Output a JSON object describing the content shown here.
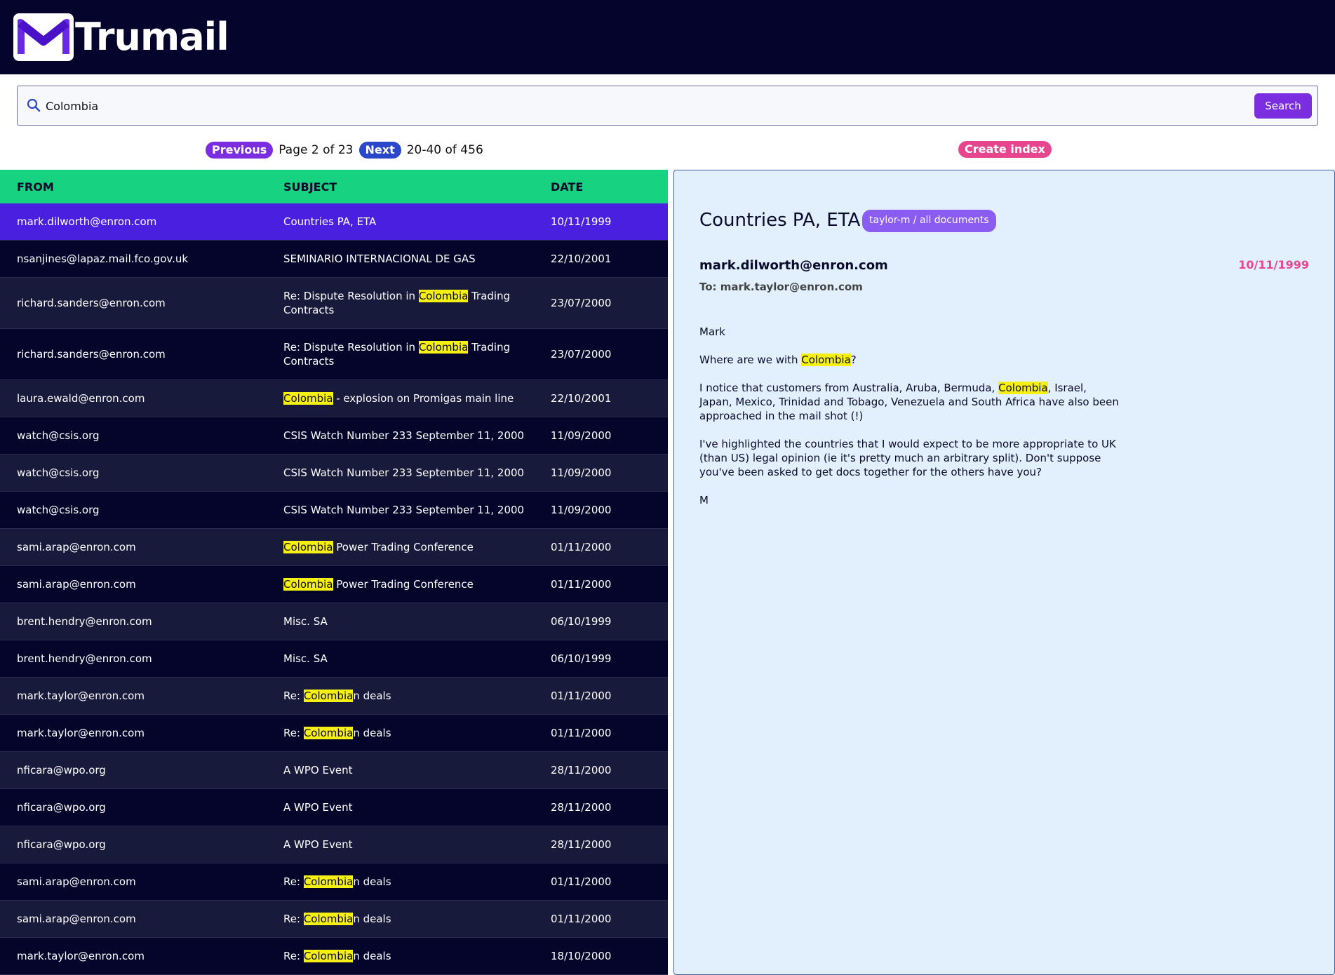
{
  "app": {
    "name": "Trumail",
    "logo_letter": "M"
  },
  "search": {
    "value": "Colombia",
    "placeholder": "",
    "button_label": "Search"
  },
  "pager": {
    "previous_label": "Previous",
    "page_text": "Page 2 of 23",
    "next_label": "Next",
    "range_text": "20-40 of 456"
  },
  "create_index_label": "Create index",
  "highlight_term": "Colombia",
  "list": {
    "headers": {
      "from": "FROM",
      "subject": "SUBJECT",
      "date": "DATE"
    },
    "rows": [
      {
        "from": "mark.dilworth@enron.com",
        "subject": "Countries PA, ETA",
        "date": "10/11/1999",
        "selected": true
      },
      {
        "from": "nsanjines@lapaz.mail.fco.gov.uk",
        "subject": "SEMINARIO INTERNACIONAL DE GAS",
        "date": "22/10/2001"
      },
      {
        "from": "richard.sanders@enron.com",
        "subject": "Re: Dispute Resolution in Colombia Trading Contracts",
        "date": "23/07/2000"
      },
      {
        "from": "richard.sanders@enron.com",
        "subject": "Re: Dispute Resolution in Colombia Trading Contracts",
        "date": "23/07/2000"
      },
      {
        "from": "laura.ewald@enron.com",
        "subject": "Colombia - explosion on Promigas main line",
        "date": "22/10/2001"
      },
      {
        "from": "watch@csis.org",
        "subject": "CSIS Watch Number 233 September 11, 2000",
        "date": "11/09/2000"
      },
      {
        "from": "watch@csis.org",
        "subject": "CSIS Watch Number 233 September 11, 2000",
        "date": "11/09/2000"
      },
      {
        "from": "watch@csis.org",
        "subject": "CSIS Watch Number 233 September 11, 2000",
        "date": "11/09/2000"
      },
      {
        "from": "sami.arap@enron.com",
        "subject": "Colombia Power Trading Conference",
        "date": "01/11/2000"
      },
      {
        "from": "sami.arap@enron.com",
        "subject": "Colombia Power Trading Conference",
        "date": "01/11/2000"
      },
      {
        "from": "brent.hendry@enron.com",
        "subject": "Misc. SA",
        "date": "06/10/1999"
      },
      {
        "from": "brent.hendry@enron.com",
        "subject": "Misc. SA",
        "date": "06/10/1999"
      },
      {
        "from": "mark.taylor@enron.com",
        "subject": "Re: Colombian deals",
        "date": "01/11/2000"
      },
      {
        "from": "mark.taylor@enron.com",
        "subject": "Re: Colombian deals",
        "date": "01/11/2000"
      },
      {
        "from": "nficara@wpo.org",
        "subject": "A WPO Event",
        "date": "28/11/2000"
      },
      {
        "from": "nficara@wpo.org",
        "subject": "A WPO Event",
        "date": "28/11/2000"
      },
      {
        "from": "nficara@wpo.org",
        "subject": "A WPO Event",
        "date": "28/11/2000"
      },
      {
        "from": "sami.arap@enron.com",
        "subject": "Re: Colombian deals",
        "date": "01/11/2000"
      },
      {
        "from": "sami.arap@enron.com",
        "subject": "Re: Colombian deals",
        "date": "01/11/2000"
      },
      {
        "from": "mark.taylor@enron.com",
        "subject": "Re: Colombian deals",
        "date": "18/10/2000"
      }
    ]
  },
  "preview": {
    "subject": "Countries PA, ETA",
    "badge": "taylor-m / all documents",
    "from": "mark.dilworth@enron.com",
    "date": "10/11/1999",
    "to": "To: mark.taylor@enron.com",
    "body": [
      "Mark",
      "Where are we with Colombia?",
      "I notice that customers from Australia, Aruba, Bermuda, Colombia, Israel, Japan, Mexico, Trinidad and Tobago, Venezuela and South Africa have also been approached in the mail shot (!)",
      "I've highlighted the countries that I would expect to be more appropriate to UK (than US) legal opinion (ie it's pretty much an arbitrary split). Don't suppose you've been asked to get docs together for the others have you?",
      "M"
    ]
  },
  "colors": {
    "topbar": "#04042c",
    "accent_purple": "#7b2ee0",
    "header_green": "#16d281",
    "selected_row": "#4a1fe0",
    "highlight": "#f6ef12",
    "pink": "#e8458f",
    "preview_bg": "#e1f0fc"
  }
}
